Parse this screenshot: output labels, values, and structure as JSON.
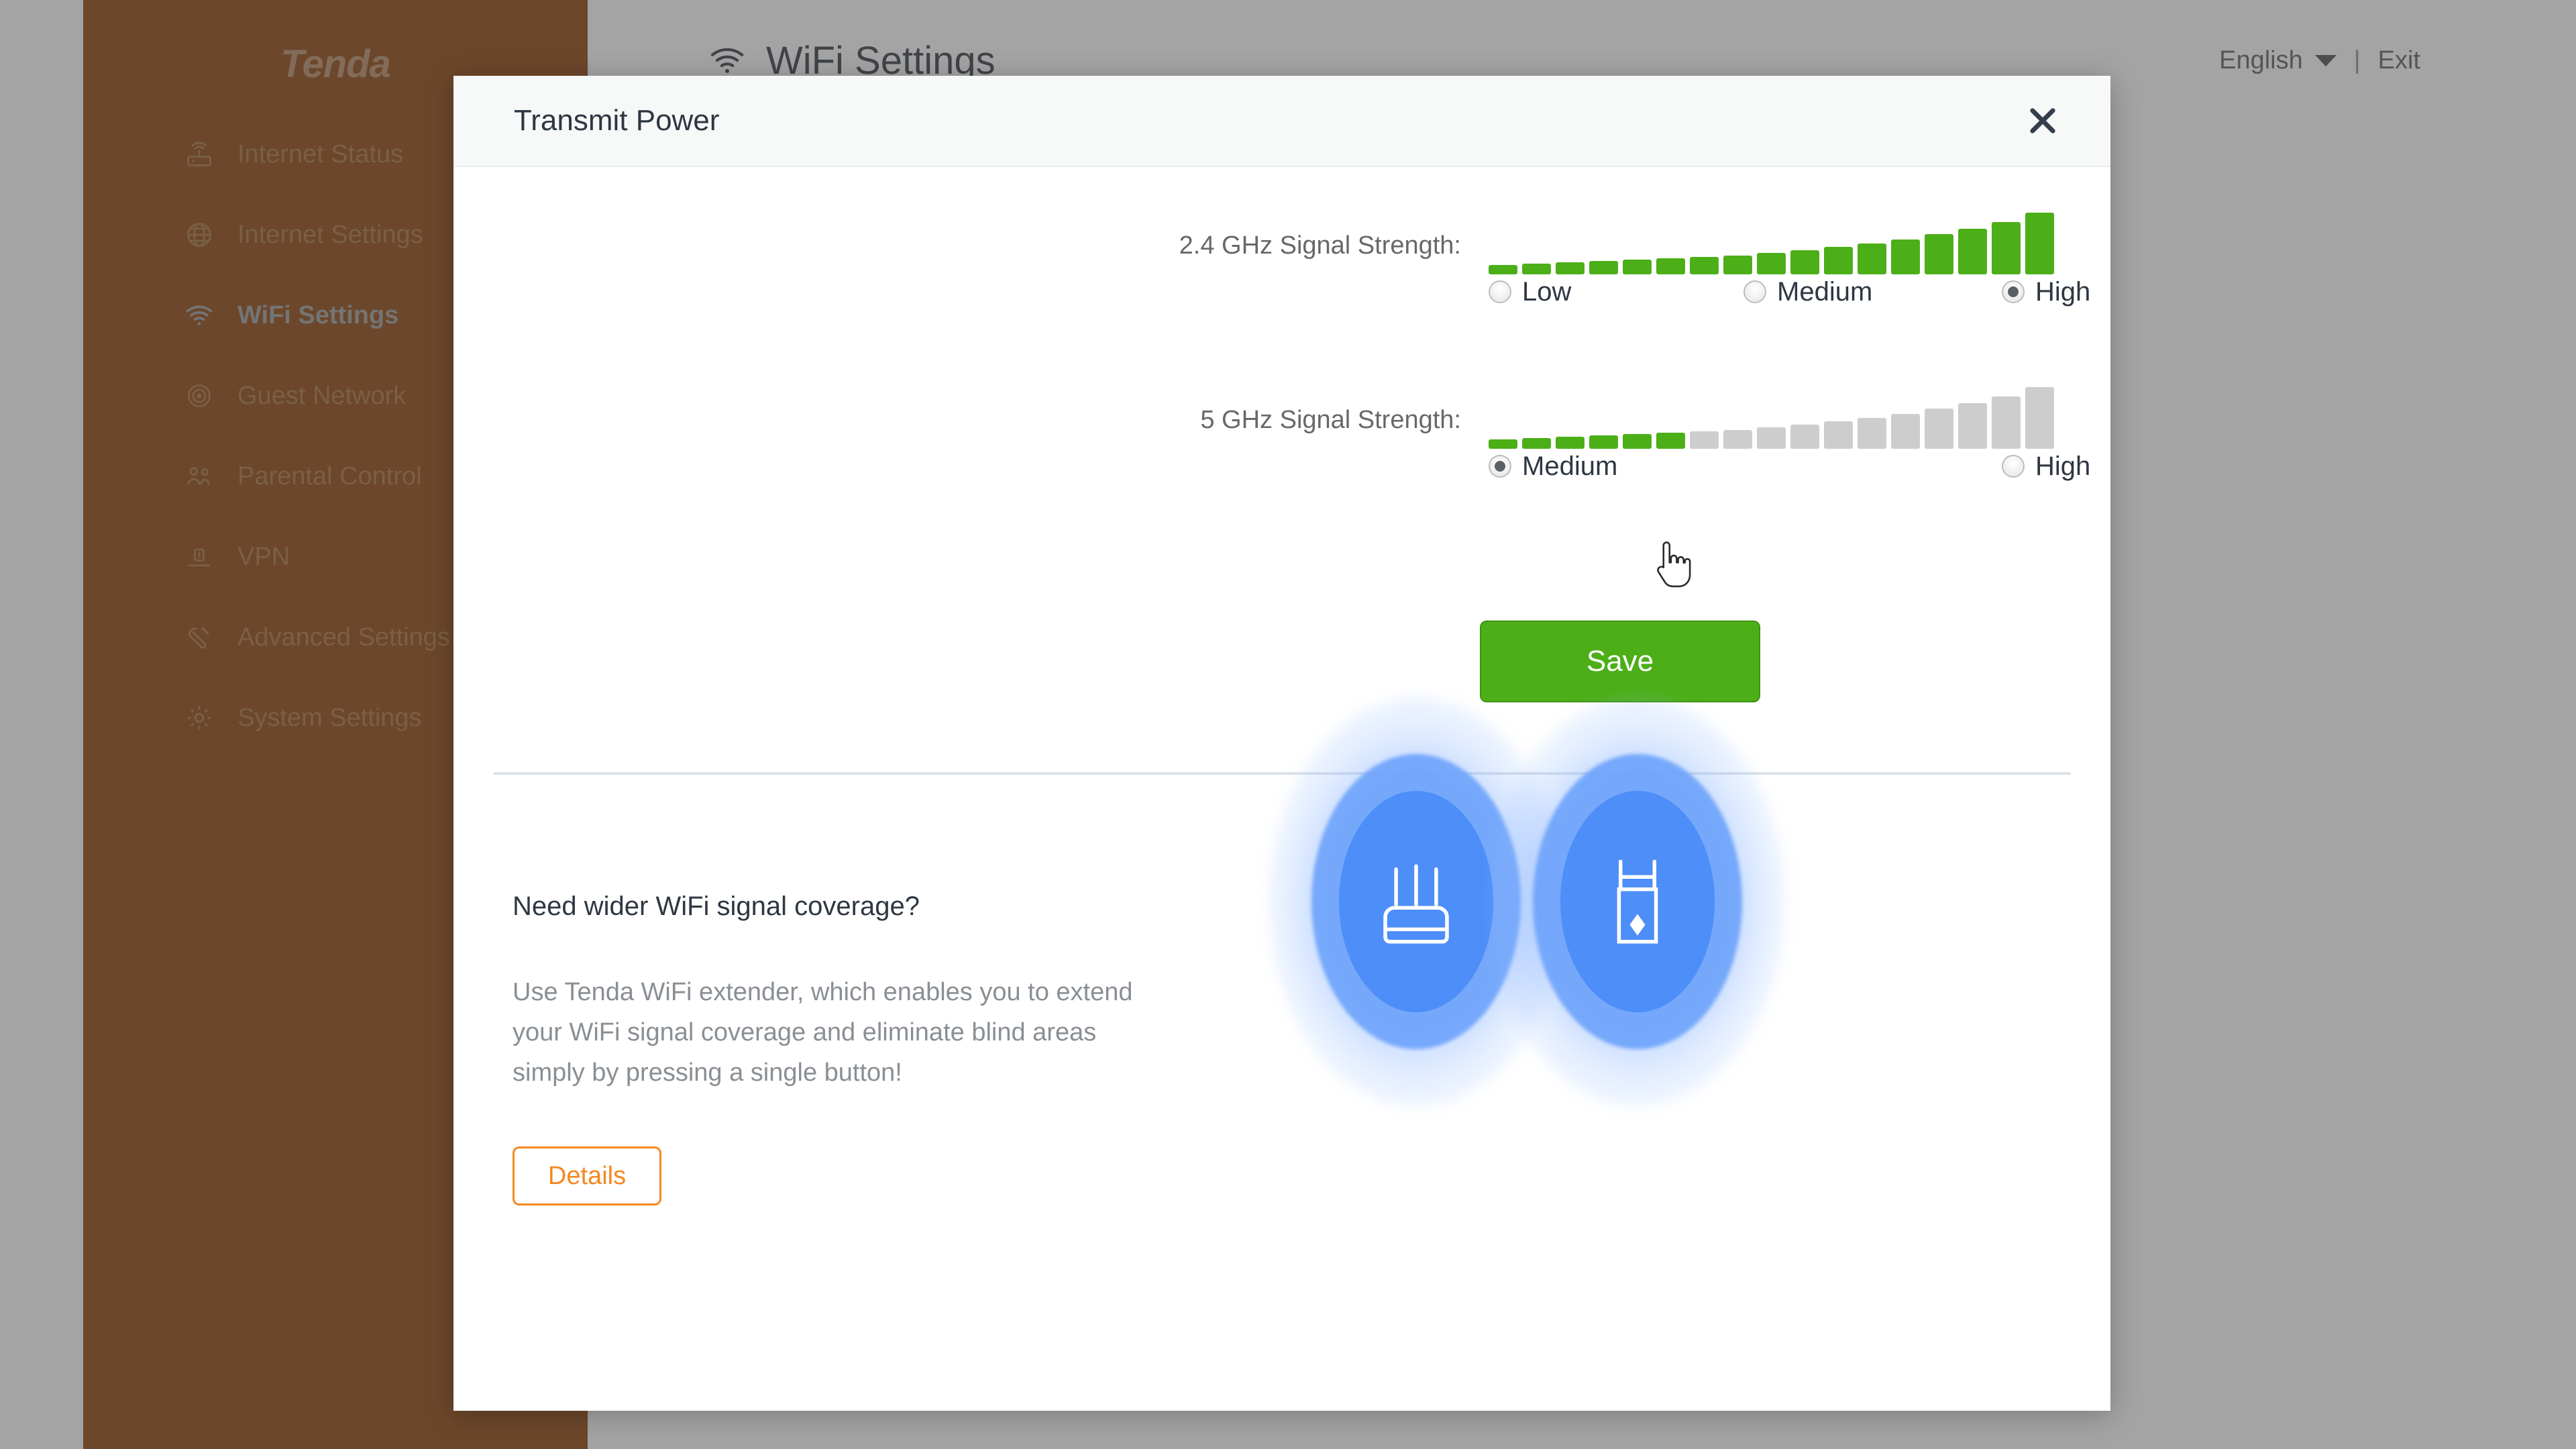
{
  "brand": {
    "logo_text": "Tenda",
    "accent_orange": "#f5881f",
    "sidebar_bg": "#8a3e04",
    "green": "#4caf18"
  },
  "sidebar": {
    "items": [
      {
        "label": "Internet Status",
        "icon": "router-icon",
        "active": false
      },
      {
        "label": "Internet Settings",
        "icon": "globe-icon",
        "active": false
      },
      {
        "label": "WiFi Settings",
        "icon": "wifi-icon",
        "active": true
      },
      {
        "label": "Guest Network",
        "icon": "guest-network-icon",
        "active": false
      },
      {
        "label": "Parental Control",
        "icon": "parental-icon",
        "active": false
      },
      {
        "label": "VPN",
        "icon": "vpn-lock-icon",
        "active": false
      },
      {
        "label": "Advanced Settings",
        "icon": "wrench-icon",
        "active": false
      },
      {
        "label": "System Settings",
        "icon": "gear-icon",
        "active": false
      }
    ]
  },
  "topbar": {
    "page_title": "WiFi Settings",
    "page_title_icon": "wifi-icon",
    "language": "English",
    "language_caret_icon": "chevron-down-icon",
    "separator": "|",
    "exit": "Exit"
  },
  "modal": {
    "title": "Transmit Power",
    "close_icon": "close-icon",
    "bands": [
      {
        "label": "2.4 GHz Signal Strength:",
        "total_bars": 17,
        "filled_bars": 17,
        "fill_color": "#4caf18",
        "empty_color": "#cdcdcd",
        "options": [
          {
            "label": "Low",
            "selected": false
          },
          {
            "label": "Medium",
            "selected": false
          },
          {
            "label": "High",
            "selected": true
          }
        ]
      },
      {
        "label": "5 GHz Signal Strength:",
        "total_bars": 17,
        "filled_bars": 6,
        "fill_color": "#4caf18",
        "empty_color": "#cdcdcd",
        "options": [
          {
            "label": "Medium",
            "selected": true
          },
          {
            "label": "High",
            "selected": false
          }
        ]
      }
    ],
    "save_label": "Save",
    "promo": {
      "heading": "Need wider WiFi signal coverage?",
      "body": "Use Tenda WiFi extender, which enables you to extend your WiFi signal coverage and eliminate blind areas simply by pressing a single button!",
      "details_label": "Details",
      "illustration": {
        "left_device": "router-device-icon",
        "right_device": "wifi-extender-device-icon"
      }
    }
  },
  "cursor": {
    "icon": "pointer-hand-cursor"
  }
}
